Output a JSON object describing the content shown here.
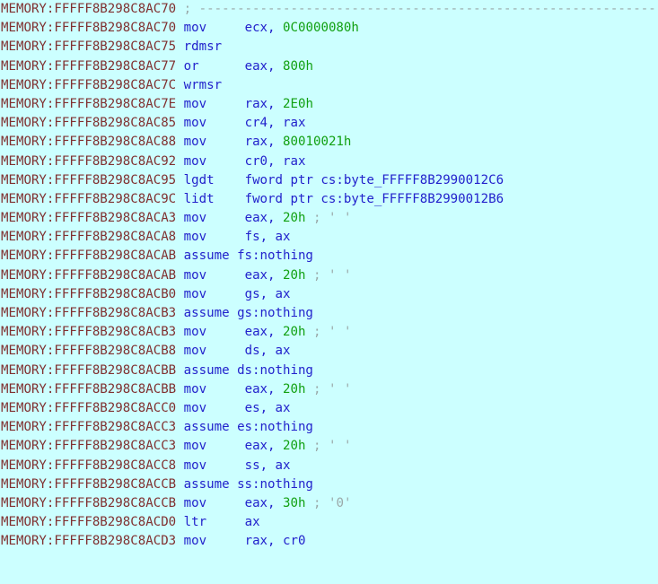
{
  "view": {
    "name": "ida-disassembly-listing",
    "segment": "MEMORY",
    "background": "#ccffff",
    "colors": {
      "address": "#803030",
      "mnemonic": "#2222cc",
      "register": "#2222cc",
      "number": "#11a011",
      "symbol": "#2222cc",
      "comment": "#9aa8a8"
    }
  },
  "lines": [
    {
      "address": "MEMORY:FFFFF8B298C8AC70",
      "kind": "comment-separator",
      "comment": "; ----------------------------------------------------------------------------------------"
    },
    {
      "address": "MEMORY:FFFFF8B298C8AC70",
      "kind": "instruction",
      "mnemonic": "mov",
      "op1": "ecx",
      "op1_type": "reg",
      "op2": "0C0000080h",
      "op2_type": "num",
      "comment": ""
    },
    {
      "address": "MEMORY:FFFFF8B298C8AC75",
      "kind": "instruction",
      "mnemonic": "rdmsr",
      "op1": "",
      "op1_type": "",
      "op2": "",
      "op2_type": "",
      "comment": ""
    },
    {
      "address": "MEMORY:FFFFF8B298C8AC77",
      "kind": "instruction",
      "mnemonic": "or",
      "op1": "eax",
      "op1_type": "reg",
      "op2": "800h",
      "op2_type": "num",
      "comment": ""
    },
    {
      "address": "MEMORY:FFFFF8B298C8AC7C",
      "kind": "instruction",
      "mnemonic": "wrmsr",
      "op1": "",
      "op1_type": "",
      "op2": "",
      "op2_type": "",
      "comment": ""
    },
    {
      "address": "MEMORY:FFFFF8B298C8AC7E",
      "kind": "instruction",
      "mnemonic": "mov",
      "op1": "rax",
      "op1_type": "reg",
      "op2": "2E0h",
      "op2_type": "num",
      "comment": ""
    },
    {
      "address": "MEMORY:FFFFF8B298C8AC85",
      "kind": "instruction",
      "mnemonic": "mov",
      "op1": "cr4",
      "op1_type": "reg",
      "op2": "rax",
      "op2_type": "reg",
      "comment": ""
    },
    {
      "address": "MEMORY:FFFFF8B298C8AC88",
      "kind": "instruction",
      "mnemonic": "mov",
      "op1": "rax",
      "op1_type": "reg",
      "op2": "80010021h",
      "op2_type": "num",
      "comment": ""
    },
    {
      "address": "MEMORY:FFFFF8B298C8AC92",
      "kind": "instruction",
      "mnemonic": "mov",
      "op1": "cr0",
      "op1_type": "reg",
      "op2": "rax",
      "op2_type": "reg",
      "comment": ""
    },
    {
      "address": "MEMORY:FFFFF8B298C8AC95",
      "kind": "instruction",
      "mnemonic": "lgdt",
      "op1": "fword ptr cs:byte_FFFFF8B2990012C6",
      "op1_type": "sym",
      "op2": "",
      "op2_type": "",
      "comment": ""
    },
    {
      "address": "MEMORY:FFFFF8B298C8AC9C",
      "kind": "instruction",
      "mnemonic": "lidt",
      "op1": "fword ptr cs:byte_FFFFF8B2990012B6",
      "op1_type": "sym",
      "op2": "",
      "op2_type": "",
      "comment": ""
    },
    {
      "address": "MEMORY:FFFFF8B298C8ACA3",
      "kind": "instruction",
      "mnemonic": "mov",
      "op1": "eax",
      "op1_type": "reg",
      "op2": "20h",
      "op2_type": "num",
      "comment": "; ' '"
    },
    {
      "address": "MEMORY:FFFFF8B298C8ACA8",
      "kind": "instruction",
      "mnemonic": "mov",
      "op1": "fs",
      "op1_type": "reg",
      "op2": "ax",
      "op2_type": "reg",
      "comment": ""
    },
    {
      "address": "MEMORY:FFFFF8B298C8ACAB",
      "kind": "assume",
      "text": "assume fs:nothing"
    },
    {
      "address": "MEMORY:FFFFF8B298C8ACAB",
      "kind": "instruction",
      "mnemonic": "mov",
      "op1": "eax",
      "op1_type": "reg",
      "op2": "20h",
      "op2_type": "num",
      "comment": "; ' '"
    },
    {
      "address": "MEMORY:FFFFF8B298C8ACB0",
      "kind": "instruction",
      "mnemonic": "mov",
      "op1": "gs",
      "op1_type": "reg",
      "op2": "ax",
      "op2_type": "reg",
      "comment": ""
    },
    {
      "address": "MEMORY:FFFFF8B298C8ACB3",
      "kind": "assume",
      "text": "assume gs:nothing"
    },
    {
      "address": "MEMORY:FFFFF8B298C8ACB3",
      "kind": "instruction",
      "mnemonic": "mov",
      "op1": "eax",
      "op1_type": "reg",
      "op2": "20h",
      "op2_type": "num",
      "comment": "; ' '"
    },
    {
      "address": "MEMORY:FFFFF8B298C8ACB8",
      "kind": "instruction",
      "mnemonic": "mov",
      "op1": "ds",
      "op1_type": "reg",
      "op2": "ax",
      "op2_type": "reg",
      "comment": ""
    },
    {
      "address": "MEMORY:FFFFF8B298C8ACBB",
      "kind": "assume",
      "text": "assume ds:nothing"
    },
    {
      "address": "MEMORY:FFFFF8B298C8ACBB",
      "kind": "instruction",
      "mnemonic": "mov",
      "op1": "eax",
      "op1_type": "reg",
      "op2": "20h",
      "op2_type": "num",
      "comment": "; ' '"
    },
    {
      "address": "MEMORY:FFFFF8B298C8ACC0",
      "kind": "instruction",
      "mnemonic": "mov",
      "op1": "es",
      "op1_type": "reg",
      "op2": "ax",
      "op2_type": "reg",
      "comment": ""
    },
    {
      "address": "MEMORY:FFFFF8B298C8ACC3",
      "kind": "assume",
      "text": "assume es:nothing"
    },
    {
      "address": "MEMORY:FFFFF8B298C8ACC3",
      "kind": "instruction",
      "mnemonic": "mov",
      "op1": "eax",
      "op1_type": "reg",
      "op2": "20h",
      "op2_type": "num",
      "comment": "; ' '"
    },
    {
      "address": "MEMORY:FFFFF8B298C8ACC8",
      "kind": "instruction",
      "mnemonic": "mov",
      "op1": "ss",
      "op1_type": "reg",
      "op2": "ax",
      "op2_type": "reg",
      "comment": ""
    },
    {
      "address": "MEMORY:FFFFF8B298C8ACCB",
      "kind": "assume",
      "text": "assume ss:nothing"
    },
    {
      "address": "MEMORY:FFFFF8B298C8ACCB",
      "kind": "instruction",
      "mnemonic": "mov",
      "op1": "eax",
      "op1_type": "reg",
      "op2": "30h",
      "op2_type": "num",
      "comment": "; '0'"
    },
    {
      "address": "MEMORY:FFFFF8B298C8ACD0",
      "kind": "instruction",
      "mnemonic": "ltr",
      "op1": "ax",
      "op1_type": "reg",
      "op2": "",
      "op2_type": "",
      "comment": ""
    },
    {
      "address": "MEMORY:FFFFF8B298C8ACD3",
      "kind": "instruction",
      "mnemonic": "mov",
      "op1": "rax",
      "op1_type": "reg",
      "op2": "cr0",
      "op2_type": "reg",
      "comment": ""
    }
  ]
}
